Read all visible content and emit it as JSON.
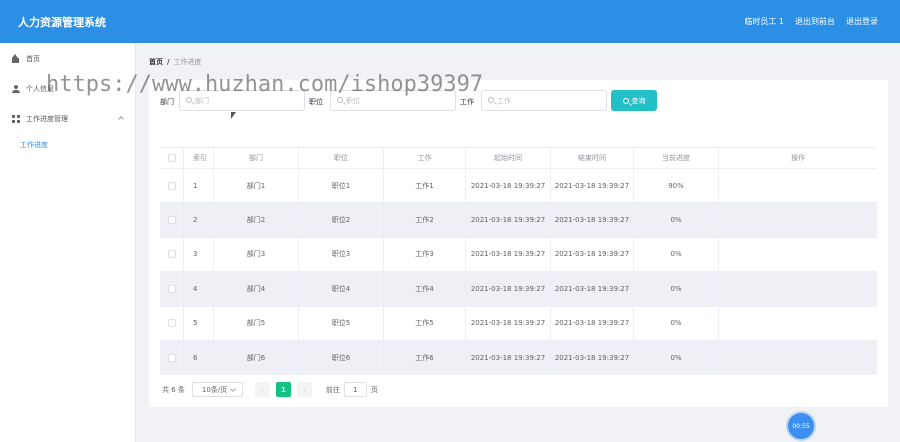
{
  "header": {
    "title": "人力资源管理系统",
    "links": [
      "临时员工 1",
      "退出到前台",
      "退出登录"
    ]
  },
  "sidebar": {
    "items": [
      {
        "label": "首页",
        "icon": "home-icon"
      },
      {
        "label": "个人信息",
        "icon": "user-icon"
      },
      {
        "label": "工作进度管理",
        "icon": "grid-icon"
      }
    ],
    "subitem": "工作进度"
  },
  "breadcrumb": {
    "home": "首页",
    "sep": "/",
    "current": "工作进度"
  },
  "filters": {
    "dept_label": "部门",
    "dept_placeholder": "部门",
    "pos_label": "职位",
    "pos_placeholder": "职位",
    "work_label": "工作",
    "work_placeholder": "工作",
    "query_label": "查询"
  },
  "table": {
    "headers": [
      "索引",
      "部门",
      "职位",
      "工作",
      "起始时间",
      "结束时间",
      "当前进度",
      "操作"
    ],
    "rows": [
      {
        "idx": "1",
        "dept": "部门1",
        "pos": "职位1",
        "work": "工作1",
        "start": "2021-03-18 19:39:27",
        "end": "2021-03-18 19:39:27",
        "progress": "90%"
      },
      {
        "idx": "2",
        "dept": "部门2",
        "pos": "职位2",
        "work": "工作2",
        "start": "2021-03-18 19:39:27",
        "end": "2021-03-18 19:39:27",
        "progress": "0%"
      },
      {
        "idx": "3",
        "dept": "部门3",
        "pos": "职位3",
        "work": "工作3",
        "start": "2021-03-18 19:39:27",
        "end": "2021-03-18 19:39:27",
        "progress": "0%"
      },
      {
        "idx": "4",
        "dept": "部门4",
        "pos": "职位4",
        "work": "工作4",
        "start": "2021-03-18 19:39:27",
        "end": "2021-03-18 19:39:27",
        "progress": "0%"
      },
      {
        "idx": "5",
        "dept": "部门5",
        "pos": "职位5",
        "work": "工作5",
        "start": "2021-03-18 19:39:27",
        "end": "2021-03-18 19:39:27",
        "progress": "0%"
      },
      {
        "idx": "6",
        "dept": "部门6",
        "pos": "职位6",
        "work": "工作6",
        "start": "2021-03-18 19:39:27",
        "end": "2021-03-18 19:39:27",
        "progress": "0%"
      }
    ]
  },
  "pagination": {
    "total": "共 6 条",
    "page_size": "10条/页",
    "prev": "‹",
    "current": "1",
    "next": "›",
    "goto": "前往",
    "jump_value": "1",
    "page_unit": "页"
  },
  "watermark": "https://www.huzhan.com/ishop39397",
  "timer": "00:55",
  "colors": {
    "header_bg": "#2c8fe6",
    "query_btn": "#23c0c8",
    "active_page": "#13c281",
    "active_menu": "#2c8fe6"
  }
}
